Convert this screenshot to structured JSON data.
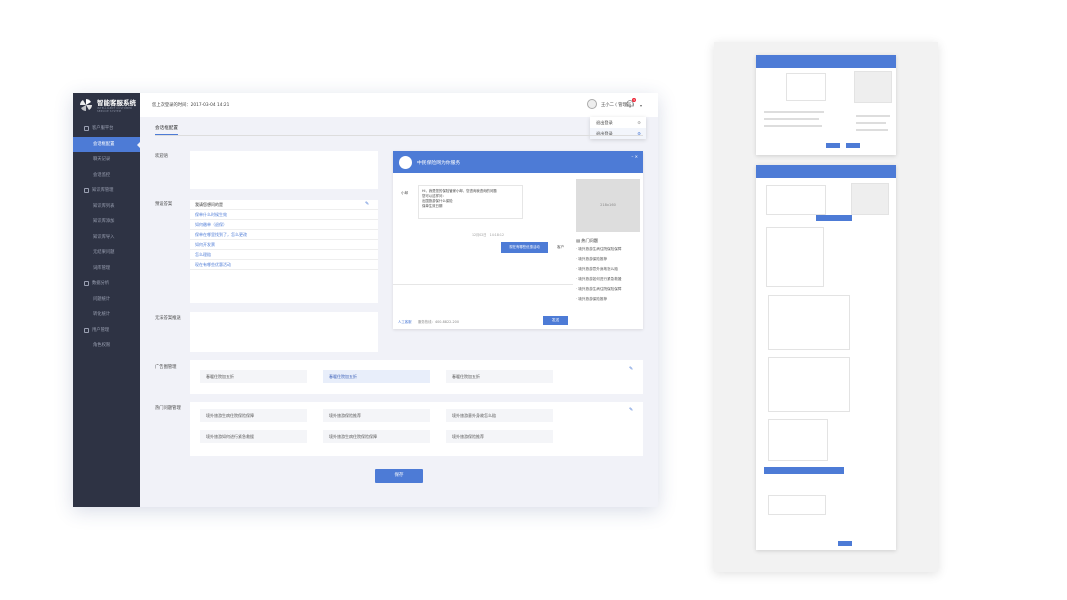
{
  "app": {
    "title": "智能客服系统",
    "subtitle": "INTELLIGENT CUSTOMER SERVICE SYSTEM"
  },
  "sidebar": {
    "items": [
      {
        "label": "客户服平台",
        "group": true
      },
      {
        "label": "会话框配置",
        "active": true
      },
      {
        "label": "聊天记录"
      },
      {
        "label": "会话监控"
      },
      {
        "label": "知识库管理",
        "group": true
      },
      {
        "label": "知识库列表"
      },
      {
        "label": "知识库添加"
      },
      {
        "label": "知识库导入"
      },
      {
        "label": "无结果问题"
      },
      {
        "label": "词库管理"
      },
      {
        "label": "数据分析",
        "group": true
      },
      {
        "label": "问题统计"
      },
      {
        "label": "转化统计"
      },
      {
        "label": "用户管理",
        "group": true
      },
      {
        "label": "角色权限"
      }
    ]
  },
  "header": {
    "last_login": "您上次登录的时间：2017-03-04 14:21",
    "notif_count": "3",
    "user": "王小二 ( 管理员 )",
    "menu": [
      "退出登录",
      "退出登录"
    ]
  },
  "main": {
    "tab": "会话框配置",
    "welcome_label": "欢迎语",
    "preset_label": "预设答案",
    "preset_list": [
      "我请您想问的是",
      "保单什么时候生效",
      "如何缴单（退保）",
      "保单在哪里找到了，怎么更改",
      "如何开发票",
      "怎么理赔",
      "现在有哪些优惠活动"
    ],
    "noanswer_label": "无法答案推送",
    "ad_label": "广告图管理",
    "ads": [
      "春暖住院加五折",
      "春暖住院加五折",
      "春暖住院加五折"
    ],
    "hot_label": "热门问题管理",
    "hot": [
      "境外旅游生病住院保险保障",
      "境外旅游保险推荐",
      "境外旅游意外身故怎么赔",
      "境外旅游如何进行紧急救援",
      "境外旅游生病住院保险保障",
      "境外旅游保险推荐"
    ],
    "save": "保存"
  },
  "preview": {
    "title": "中民保险网为你服务",
    "bot_name": "小邮",
    "bot_msg": "Hi，我是您的保险管家小邮，您咨询我咨询的问题",
    "bot_sub": "您可以这样问：\n出国旅游保什么保险\n保单生效日期",
    "time": "12月02日　14:18:12",
    "user_msg": "现在有哪些优惠活动",
    "user_name": "客户",
    "side_img": "218x160",
    "hot_title": "热门问题",
    "hot": [
      "境外旅游生病住院保险保障",
      "境外旅游保险推荐",
      "境外旅游意外身故怎么赔",
      "境外旅游如何进行紧急救援",
      "境外旅游生病住院保险保障",
      "境外旅游保险推荐"
    ],
    "human": "人工客服",
    "hotline": "服务热线：400-8822-200",
    "send": "发送"
  },
  "colors": {
    "accent": "#4d7bd6",
    "sidebar": "#2e3344"
  }
}
